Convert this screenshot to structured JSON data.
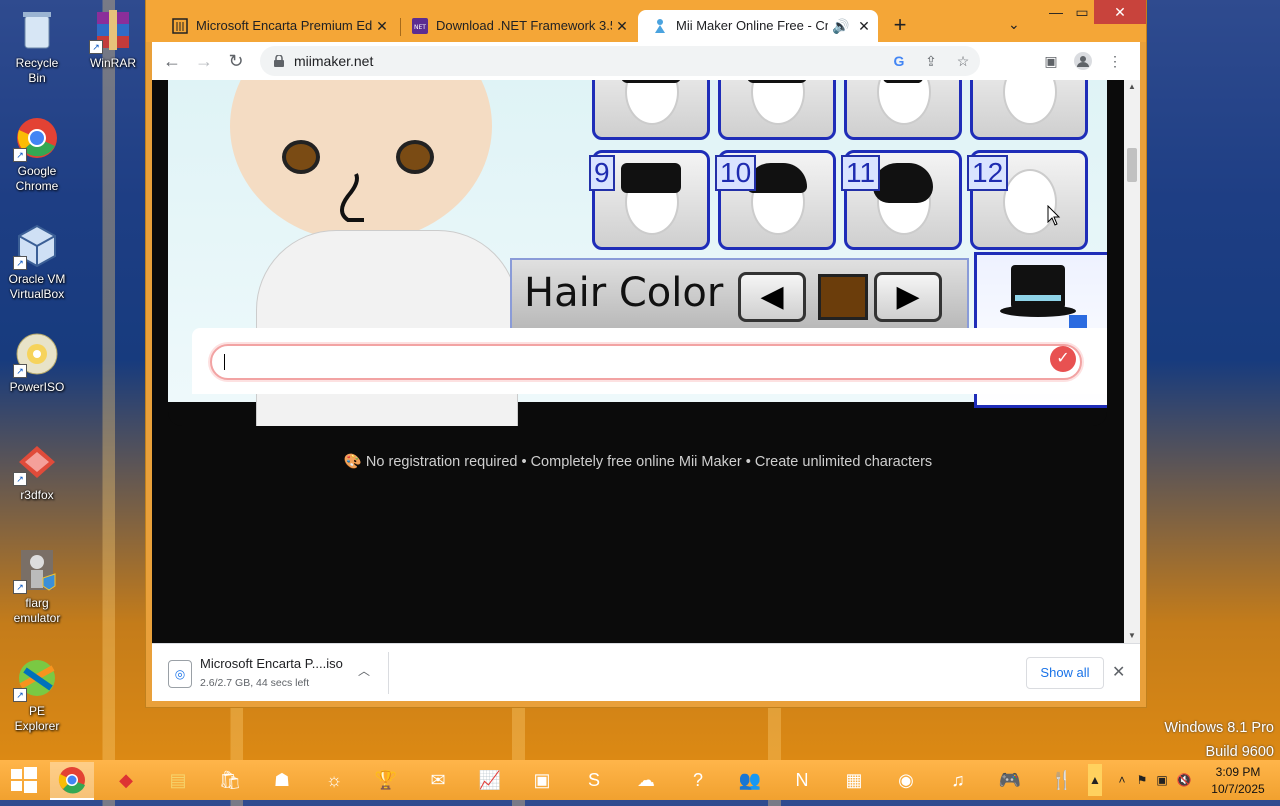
{
  "desktop": {
    "icons": [
      {
        "label": "Recycle Bin"
      },
      {
        "label": "WinRAR"
      },
      {
        "label": "Google Chrome"
      },
      {
        "label": "Oracle VM VirtualBox"
      },
      {
        "label": "PowerISO"
      },
      {
        "label": "r3dfox"
      },
      {
        "label": "flarg emulator"
      },
      {
        "label": "PE Explorer"
      }
    ],
    "watermark": {
      "line1": "Windows 8.1 Pro",
      "line2": "Build 9600"
    }
  },
  "browser": {
    "tabs": [
      {
        "title": "Microsoft Encarta Premium Editio",
        "active": false
      },
      {
        "title": "Download .NET Framework 3.5 SP",
        "active": false
      },
      {
        "title": "Mii Maker Online Free - Crea",
        "active": true,
        "audio": true
      }
    ],
    "url": "miimaker.net",
    "page": {
      "hair_numbers": [
        "9",
        "10",
        "11",
        "12"
      ],
      "hair_color_label": "Hair Color",
      "hair_color_value": "#6b3d0b",
      "input_value": "",
      "footer": "🎨 No registration required • Completely free online Mii Maker • Create unlimited characters"
    },
    "download": {
      "filename": "Microsoft Encarta P....iso",
      "status": "2.6/2.7 GB, 44 secs left",
      "show_all": "Show all"
    }
  },
  "taskbar": {
    "clock_time": "3:09 PM",
    "clock_date": "10/7/2025"
  }
}
